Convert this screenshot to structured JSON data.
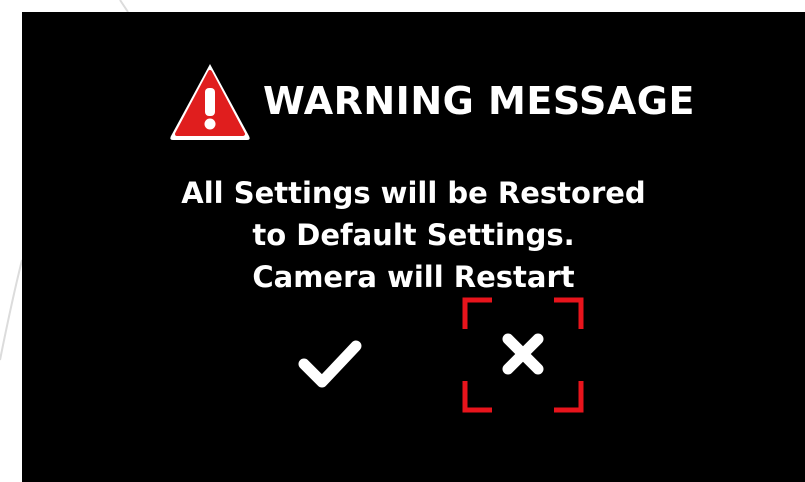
{
  "dialog": {
    "title": "WARNING MESSAGE",
    "message_lines": [
      "All Settings will be Restored",
      "to Default Settings.",
      "Camera will Restart"
    ],
    "icons": {
      "warning": "warning-triangle-icon",
      "confirm": "checkmark-icon",
      "cancel": "cross-icon"
    },
    "selected_option": "cancel"
  },
  "colors": {
    "background": "#000000",
    "text": "#ffffff",
    "warning_red": "#e01e1e",
    "selection_red": "#e8141c"
  }
}
